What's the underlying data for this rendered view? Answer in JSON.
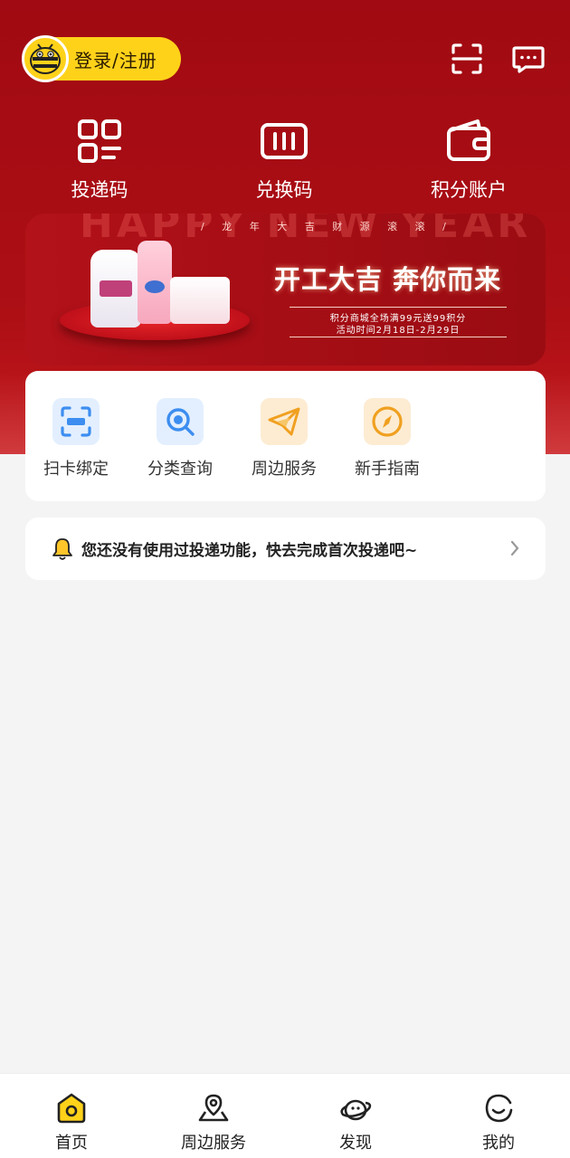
{
  "header": {
    "login_label": "登录/注册",
    "scan_icon": "scan-icon",
    "message_icon": "message-icon"
  },
  "quick_actions": [
    {
      "label": "投递码",
      "icon": "grid-code-icon"
    },
    {
      "label": "兑换码",
      "icon": "ticket-code-icon"
    },
    {
      "label": "积分账户",
      "icon": "wallet-icon"
    }
  ],
  "banner": {
    "watermark": "HAPPY NEW YEAR",
    "subtitle": "/ 龙 年 大 吉  财 源 滚 滚 /",
    "title": "开工大吉 奔你而来",
    "note_line1": "积分商城全场满99元送99积分",
    "note_line2": "活动时间2月18日-2月29日"
  },
  "services": [
    {
      "label": "扫卡绑定",
      "icon": "scan-card-icon",
      "color": "#3d8ef0"
    },
    {
      "label": "分类查询",
      "icon": "search-icon",
      "color": "#3d8ef0"
    },
    {
      "label": "周边服务",
      "icon": "paper-plane-icon",
      "color": "#f0a020"
    },
    {
      "label": "新手指南",
      "icon": "compass-icon",
      "color": "#f0a020"
    }
  ],
  "notice": {
    "text": "您还没有使用过投递功能，快去完成首次投递吧~"
  },
  "tabbar": [
    {
      "label": "首页",
      "icon": "home-icon",
      "active": true
    },
    {
      "label": "周边服务",
      "icon": "location-icon",
      "active": false
    },
    {
      "label": "发现",
      "icon": "discover-icon",
      "active": false
    },
    {
      "label": "我的",
      "icon": "profile-icon",
      "active": false
    }
  ],
  "colors": {
    "primary_red": "#a10a12",
    "accent_yellow": "#ffd21a",
    "blue_icon": "#3d8ef0",
    "orange_icon": "#f0a020"
  }
}
